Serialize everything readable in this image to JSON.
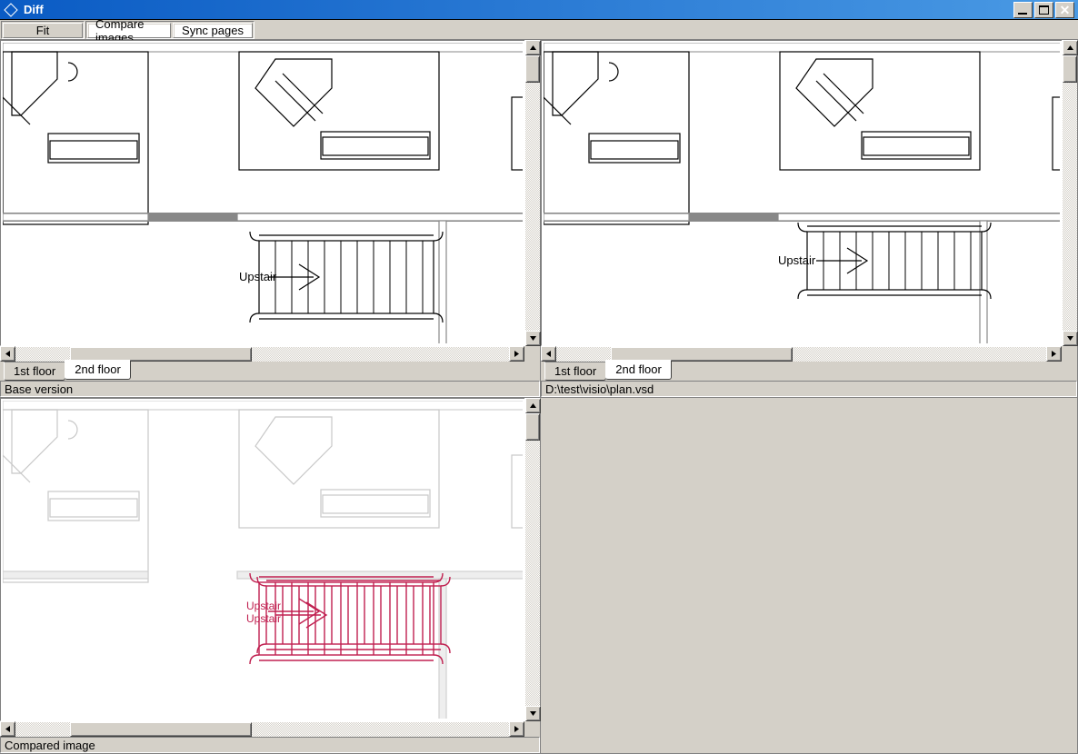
{
  "window": {
    "title": "Diff"
  },
  "toolbar": {
    "fit_label": "Fit",
    "compare_label": "Compare images",
    "sync_label": "Sync pages"
  },
  "tabs": {
    "floor1": "1st floor",
    "floor2": "2nd floor"
  },
  "labels": {
    "upstair": "Upstair"
  },
  "captions": {
    "base": "Base version",
    "path": "D:\\test\\visio\\plan.vsd",
    "compared": "Compared image"
  }
}
